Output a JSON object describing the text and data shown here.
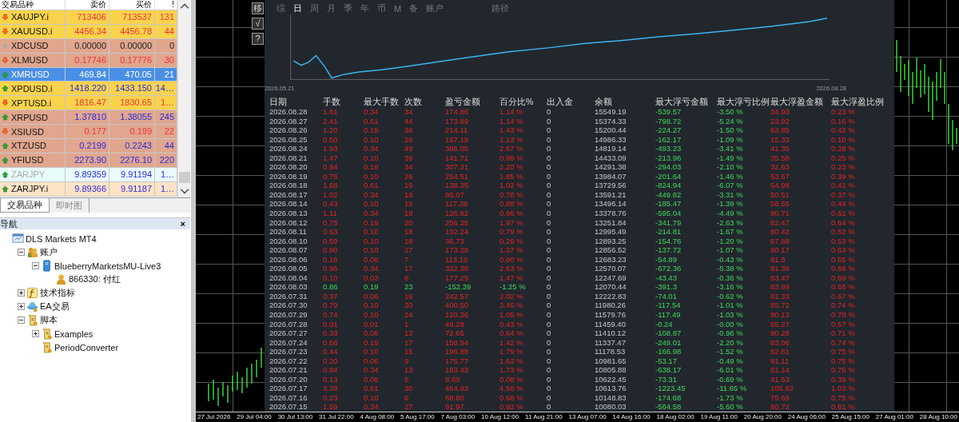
{
  "market": {
    "columns": [
      "交易品种",
      "卖价",
      "买价",
      "!"
    ],
    "rows": [
      {
        "symbol": "XAUJPY.i",
        "bid": "713406",
        "ask": "713537",
        "spread": "131",
        "kind": "down",
        "color": "#f9d34c",
        "selected": false,
        "disabled": false
      },
      {
        "symbol": "XAUUSD.i",
        "bid": "4456.34",
        "ask": "4456.78",
        "spread": "44",
        "kind": "down",
        "color": "#f9d34c",
        "selected": false,
        "disabled": false
      },
      {
        "symbol": "XDCUSD",
        "bid": "0.00000",
        "ask": "0.00000",
        "spread": "0",
        "kind": "flat",
        "color": "#e0a68e",
        "selected": false,
        "disabled": false
      },
      {
        "symbol": "XLMUSD",
        "bid": "0.17746",
        "ask": "0.17776",
        "spread": "30",
        "kind": "down",
        "color": "#e0a68e",
        "selected": false,
        "disabled": false
      },
      {
        "symbol": "XMRUSD",
        "bid": "469.84",
        "ask": "470.05",
        "spread": "21",
        "kind": "up",
        "color": "#4a8fe6",
        "selected": true,
        "disabled": false
      },
      {
        "symbol": "XPDUSD.i",
        "bid": "1418.220",
        "ask": "1433.150",
        "spread": "14…",
        "kind": "up",
        "color": "#f9d34c",
        "selected": false,
        "disabled": false
      },
      {
        "symbol": "XPTUSD.i",
        "bid": "1816.47",
        "ask": "1830.65",
        "spread": "1…",
        "kind": "down",
        "color": "#f9d34c",
        "selected": false,
        "disabled": false
      },
      {
        "symbol": "XRPUSD",
        "bid": "1.37810",
        "ask": "1.38055",
        "spread": "245",
        "kind": "up",
        "color": "#e0a68e",
        "selected": false,
        "disabled": false
      },
      {
        "symbol": "XSIUSD",
        "bid": "0.177",
        "ask": "0.199",
        "spread": "22",
        "kind": "down",
        "color": "#e0a68e",
        "selected": false,
        "disabled": false
      },
      {
        "symbol": "XTZUSD",
        "bid": "0.2199",
        "ask": "0.2243",
        "spread": "44",
        "kind": "up",
        "color": "#e0a68e",
        "selected": false,
        "disabled": false
      },
      {
        "symbol": "YFIUSD",
        "bid": "2273.90",
        "ask": "2276.10",
        "spread": "220",
        "kind": "up",
        "color": "#e0a68e",
        "selected": false,
        "disabled": false
      },
      {
        "symbol": "ZARJPY",
        "bid": "9.89359",
        "ask": "9.91194",
        "spread": "1…",
        "kind": "up",
        "color": "#e8fcfc",
        "selected": false,
        "disabled": true
      },
      {
        "symbol": "ZARJPY.i",
        "bid": "9.89366",
        "ask": "9.91187",
        "spread": "1…",
        "kind": "up",
        "color": "#fde3c6",
        "selected": false,
        "disabled": false
      }
    ],
    "tabs": [
      {
        "label": "交易品种",
        "selected": true
      },
      {
        "label": "即时图",
        "selected": false
      }
    ]
  },
  "navigator": {
    "title": "导航",
    "close": "×",
    "tree": [
      {
        "label": "DLS Markets MT4",
        "kind": "terminal",
        "children": [
          {
            "label": "账户",
            "kind": "accounts",
            "expanded": true,
            "children": [
              {
                "label": "BlueberryMarketsMU-Live3",
                "kind": "server",
                "expanded": true,
                "children": [
                  {
                    "label": "866330: 付红",
                    "kind": "user"
                  }
                ]
              }
            ]
          },
          {
            "label": "技术指标",
            "kind": "indicator",
            "expanded": false
          },
          {
            "label": "EA交易",
            "kind": "expert",
            "expanded": false
          },
          {
            "label": "脚本",
            "kind": "script",
            "expanded": true,
            "children": [
              {
                "label": "Examples",
                "kind": "script",
                "expanded": false
              },
              {
                "label": "PeriodConverter",
                "kind": "script"
              }
            ]
          }
        ]
      }
    ]
  },
  "side_buttons": [
    "移",
    "√",
    "?"
  ],
  "report": {
    "tabs": [
      {
        "label": "综",
        "selected": false
      },
      {
        "label": "日",
        "selected": true
      },
      {
        "label": "周",
        "selected": false
      },
      {
        "label": "月",
        "selected": false
      },
      {
        "label": "季",
        "selected": false
      },
      {
        "label": "年",
        "selected": false
      },
      {
        "label": "币",
        "selected": false
      },
      {
        "label": "M",
        "selected": false
      },
      {
        "label": "备",
        "selected": false
      },
      {
        "label": "账户",
        "selected": false
      },
      {
        "label": "路径",
        "selected": false
      }
    ],
    "chart": {
      "start_label": "2026.05.21",
      "end_label": "2026.08.28"
    },
    "columns": [
      "日期",
      "手数",
      "最大手数",
      "次数",
      "盈亏金额",
      "百分比%",
      "出入金",
      "余额",
      "最大浮亏金额",
      "最大浮亏比例",
      "最大浮盈金额",
      "最大浮盈比例"
    ],
    "rows": [
      {
        "profit": true,
        "cells": [
          "2026.08.28",
          "1.61",
          "0.34",
          "34",
          "174.86",
          "1.14 %",
          "0",
          "15549.19",
          "-539.57",
          "-3.50 %",
          "34.93",
          "0.23 %"
        ]
      },
      {
        "profit": true,
        "cells": [
          "2026.08.27",
          "2.41",
          "0.61",
          "44",
          "173.89",
          "1.14 %",
          "0",
          "15374.33",
          "-798.72",
          "-5.24 %",
          "23.92",
          "0.16 %"
        ]
      },
      {
        "profit": true,
        "cells": [
          "2026.08.26",
          "1.20",
          "0.19",
          "36",
          "214.11",
          "1.43 %",
          "0",
          "15200.44",
          "-224.27",
          "-1.50 %",
          "63.85",
          "0.42 %"
        ]
      },
      {
        "profit": true,
        "cells": [
          "2026.08.25",
          "0.50",
          "0.10",
          "26",
          "167.19",
          "1.13 %",
          "0",
          "14986.33",
          "-162.17",
          "-1.09 %",
          "15.33",
          "0.10 %"
        ]
      },
      {
        "profit": true,
        "cells": [
          "2026.08.24",
          "1.93",
          "0.34",
          "49",
          "386.05",
          "2.67 %",
          "0",
          "14819.14",
          "-493.23",
          "-3.41 %",
          "41.35",
          "0.28 %"
        ]
      },
      {
        "profit": true,
        "cells": [
          "2026.08.21",
          "1.47",
          "0.10",
          "39",
          "141.71",
          "0.99 %",
          "0",
          "14433.09",
          "-213.96",
          "-1.49 %",
          "35.58",
          "0.25 %"
        ]
      },
      {
        "profit": true,
        "cells": [
          "2026.08.20",
          "0.94",
          "0.19",
          "34",
          "307.31",
          "2.20 %",
          "0",
          "14291.38",
          "-294.03",
          "-2.10 %",
          "32.63",
          "0.23 %"
        ]
      },
      {
        "profit": true,
        "cells": [
          "2026.08.19",
          "0.75",
          "0.10",
          "26",
          "254.51",
          "1.85 %",
          "0",
          "13984.07",
          "-201.64",
          "-1.46 %",
          "53.67",
          "0.39 %"
        ]
      },
      {
        "profit": true,
        "cells": [
          "2026.08.18",
          "1.68",
          "0.61",
          "19",
          "138.35",
          "1.02 %",
          "0",
          "13729.56",
          "-824.94",
          "-6.07 %",
          "54.98",
          "0.41 %"
        ]
      },
      {
        "profit": true,
        "cells": [
          "2026.08.17",
          "1.02",
          "0.34",
          "19",
          "95.07",
          "0.70 %",
          "0",
          "13591.21",
          "-449.82",
          "-3.31 %",
          "50.51",
          "0.37 %"
        ]
      },
      {
        "profit": true,
        "cells": [
          "2026.08.14",
          "0.43",
          "0.10",
          "15",
          "117.38",
          "0.88 %",
          "0",
          "13496.14",
          "-185.47",
          "-1.39 %",
          "58.55",
          "0.44 %"
        ]
      },
      {
        "profit": true,
        "cells": [
          "2026.08.13",
          "1.11",
          "0.34",
          "18",
          "126.92",
          "0.96 %",
          "0",
          "13378.76",
          "-595.04",
          "-4.49 %",
          "80.71",
          "0.61 %"
        ]
      },
      {
        "profit": true,
        "cells": [
          "2026.08.12",
          "0.75",
          "0.19",
          "20",
          "256.35",
          "1.97 %",
          "0",
          "13251.84",
          "-341.79",
          "-2.63 %",
          "82.47",
          "0.64 %"
        ]
      },
      {
        "profit": true,
        "cells": [
          "2026.08.11",
          "0.63",
          "0.10",
          "18",
          "102.24",
          "0.79 %",
          "0",
          "12995.49",
          "-214.81",
          "-1.67 %",
          "80.42",
          "0.62 %"
        ]
      },
      {
        "profit": true,
        "cells": [
          "2026.08.10",
          "0.59",
          "0.10",
          "18",
          "36.73",
          "0.29 %",
          "0",
          "12893.25",
          "-154.76",
          "-1.20 %",
          "67.88",
          "0.53 %"
        ]
      },
      {
        "profit": true,
        "cells": [
          "2026.08.07",
          "0.80",
          "0.10",
          "27",
          "173.29",
          "1.37 %",
          "0",
          "12856.52",
          "-137.72",
          "-1.07 %",
          "80.17",
          "0.63 %"
        ]
      },
      {
        "profit": true,
        "cells": [
          "2026.08.06",
          "0.16",
          "0.06",
          "7",
          "113.16",
          "0.90 %",
          "0",
          "12683.23",
          "-54.89",
          "-0.43 %",
          "81.5",
          "0.65 %"
        ]
      },
      {
        "profit": true,
        "cells": [
          "2026.08.05",
          "0.96",
          "0.34",
          "17",
          "322.38",
          "2.63 %",
          "0",
          "12570.07",
          "-672.36",
          "-5.38 %",
          "81.39",
          "0.66 %"
        ]
      },
      {
        "profit": true,
        "cells": [
          "2026.08.04",
          "0.10",
          "0.03",
          "6",
          "177.25",
          "1.47 %",
          "0",
          "12247.69",
          "-43.43",
          "-0.36 %",
          "83.47",
          "0.69 %"
        ]
      },
      {
        "profit": false,
        "cells": [
          "2026.08.03",
          "0.86",
          "0.19",
          "23",
          "-152.39",
          "-1.25 %",
          "0",
          "12070.44",
          "-391.3",
          "-3.16 %",
          "83.99",
          "0.68 %"
        ]
      },
      {
        "profit": true,
        "cells": [
          "2026.07.31",
          "0.37",
          "0.06",
          "16",
          "242.57",
          "2.02 %",
          "0",
          "12222.83",
          "-74.01",
          "-0.62 %",
          "81.33",
          "0.67 %"
        ]
      },
      {
        "profit": true,
        "cells": [
          "2026.07.30",
          "0.79",
          "0.10",
          "30",
          "400.50",
          "3.46 %",
          "0",
          "11980.26",
          "-117.54",
          "-1.01 %",
          "85.72",
          "0.74 %"
        ]
      },
      {
        "profit": true,
        "cells": [
          "2026.07.29",
          "0.74",
          "0.10",
          "24",
          "120.36",
          "1.05 %",
          "0",
          "11579.76",
          "-117.49",
          "-1.03 %",
          "80.13",
          "0.70 %"
        ]
      },
      {
        "profit": true,
        "cells": [
          "2026.07.28",
          "0.01",
          "0.01",
          "1",
          "49.28",
          "0.43 %",
          "0",
          "11459.40",
          "-0.24",
          "-0.00 %",
          "65.27",
          "0.57 %"
        ]
      },
      {
        "profit": true,
        "cells": [
          "2026.07.27",
          "0.33",
          "0.06",
          "13",
          "72.65",
          "0.64 %",
          "0",
          "11410.12",
          "-108.87",
          "-0.96 %",
          "80.28",
          "0.71 %"
        ]
      },
      {
        "profit": true,
        "cells": [
          "2026.07.24",
          "0.66",
          "0.19",
          "17",
          "158.94",
          "1.42 %",
          "0",
          "11337.47",
          "-249.01",
          "-2.20 %",
          "83.06",
          "0.74 %"
        ]
      },
      {
        "profit": true,
        "cells": [
          "2026.07.23",
          "0.44",
          "0.10",
          "15",
          "196.88",
          "1.79 %",
          "0",
          "11178.53",
          "-166.98",
          "-1.52 %",
          "82.81",
          "0.75 %"
        ]
      },
      {
        "profit": true,
        "cells": [
          "2026.07.22",
          "0.20",
          "0.06",
          "9",
          "175.77",
          "1.63 %",
          "0",
          "10981.65",
          "-53.17",
          "-0.49 %",
          "81.11",
          "0.75 %"
        ]
      },
      {
        "profit": true,
        "cells": [
          "2026.07.21",
          "0.84",
          "0.34",
          "13",
          "183.43",
          "1.73 %",
          "0",
          "10805.88",
          "-638.17",
          "-6.01 %",
          "81.14",
          "0.76 %"
        ]
      },
      {
        "profit": true,
        "cells": [
          "2026.07.20",
          "0.13",
          "0.06",
          "5",
          "8.69",
          "0.08 %",
          "0",
          "10622.45",
          "-73.31",
          "-0.69 %",
          "41.53",
          "0.39 %"
        ]
      },
      {
        "profit": true,
        "cells": [
          "2026.07.17",
          "3.39",
          "0.61",
          "30",
          "464.93",
          "4.58 %",
          "0",
          "10613.76",
          "-1223.45",
          "-11.65 %",
          "105.82",
          "1.03 %"
        ]
      },
      {
        "profit": true,
        "cells": [
          "2026.07.16",
          "0.23",
          "0.10",
          "6",
          "68.80",
          "0.68 %",
          "0",
          "10148.83",
          "-174.68",
          "-1.73 %",
          "75.69",
          "0.75 %"
        ]
      },
      {
        "profit": true,
        "cells": [
          "2026.07.15",
          "1.59",
          "0.34",
          "27",
          "91.97",
          "0.92 %",
          "0",
          "10080.03",
          "-564.58",
          "-5.60 %",
          "80.72",
          "0.81 %"
        ]
      }
    ]
  },
  "time_axis": [
    "27 Jul 2026",
    "29 Jul 04:00",
    "30 Jul 13:00",
    "31 Jul 22:00",
    "4 Aug 08:00",
    "5 Aug 17:00",
    "7 Aug 03:00",
    "10 Aug 12:00",
    "11 Aug 21:00",
    "13 Aug 07:00",
    "14 Aug 16:00",
    "18 Aug 02:00",
    "19 Aug 11:00",
    "20 Aug 20:00",
    "24 Aug 06:00",
    "25 Aug 15:00",
    "27 Aug 01:00",
    "28 Aug 10:00"
  ]
}
